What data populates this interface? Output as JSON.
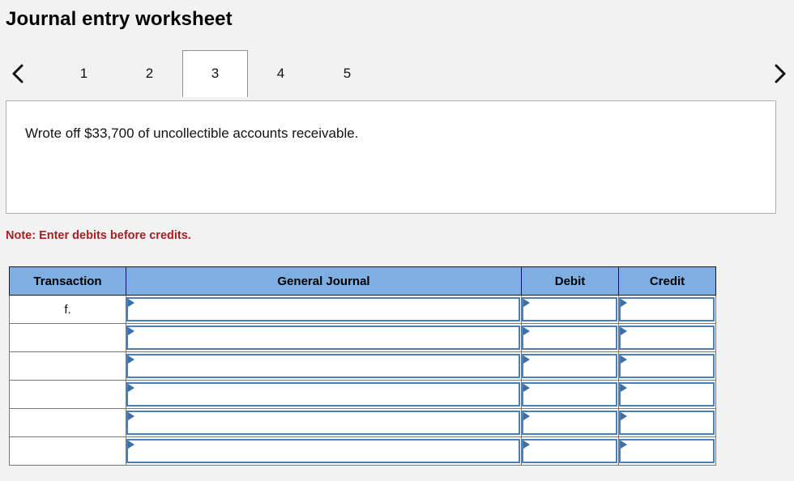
{
  "page": {
    "title": "Journal entry worksheet",
    "note": "Note: Enter debits before credits."
  },
  "tabs": {
    "prev_icon": "chevron-left-icon",
    "next_icon": "chevron-right-icon",
    "items": [
      {
        "label": "1",
        "active": false
      },
      {
        "label": "2",
        "active": false
      },
      {
        "label": "3",
        "active": true
      },
      {
        "label": "4",
        "active": false
      },
      {
        "label": "5",
        "active": false
      }
    ]
  },
  "description": {
    "text": "Wrote off $33,700 of uncollectible accounts receivable."
  },
  "journal": {
    "headers": {
      "transaction": "Transaction",
      "general_journal": "General Journal",
      "debit": "Debit",
      "credit": "Credit"
    },
    "rows": [
      {
        "transaction": "f.",
        "general_journal": "",
        "debit": "",
        "credit": ""
      },
      {
        "transaction": "",
        "general_journal": "",
        "debit": "",
        "credit": ""
      },
      {
        "transaction": "",
        "general_journal": "",
        "debit": "",
        "credit": ""
      },
      {
        "transaction": "",
        "general_journal": "",
        "debit": "",
        "credit": ""
      },
      {
        "transaction": "",
        "general_journal": "",
        "debit": "",
        "credit": ""
      },
      {
        "transaction": "",
        "general_journal": "",
        "debit": "",
        "credit": ""
      }
    ]
  },
  "colors": {
    "header_blue": "#7eaee2",
    "input_border_blue": "#4a7fba",
    "note_red": "#a52022",
    "page_background": "#f2f2f2"
  }
}
